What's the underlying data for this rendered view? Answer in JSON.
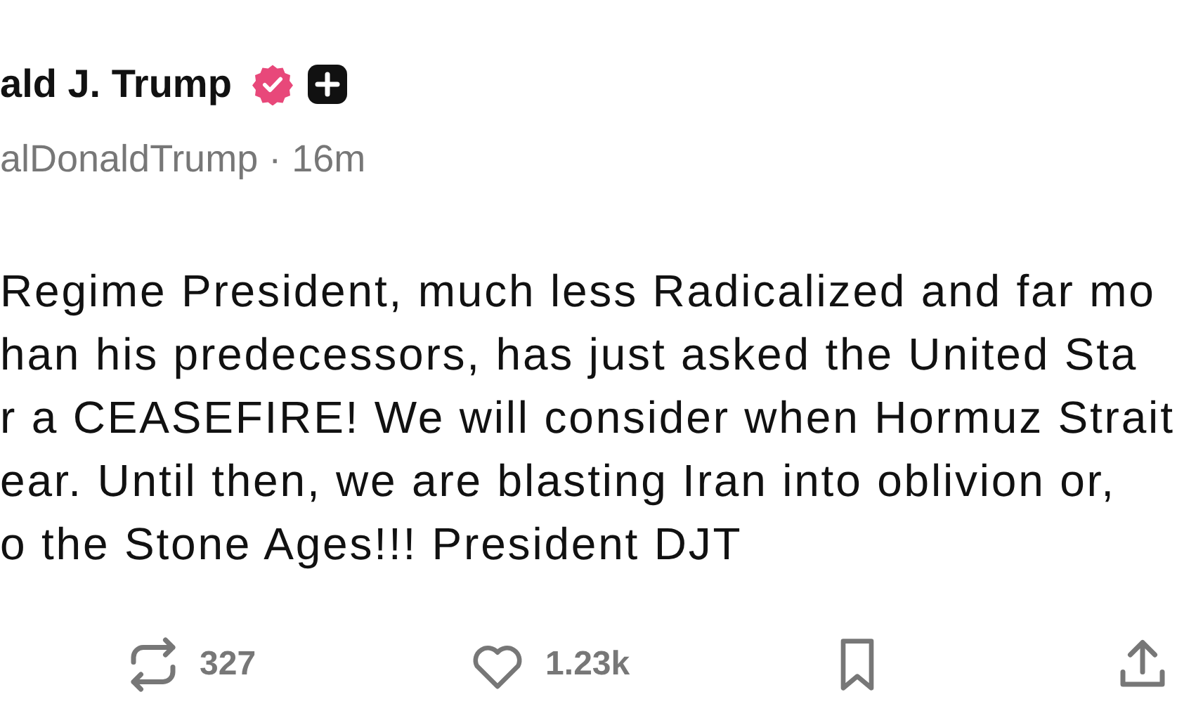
{
  "author": {
    "name": "ald J. Trump",
    "verified": true,
    "handle": "alDonaldTrump",
    "separator": "·",
    "time": "16m"
  },
  "post_lines": [
    "Regime President, much less Radicalized and far mo",
    "han his predecessors, has just asked the United Sta",
    "r a CEASEFIRE! We will consider when Hormuz Strait",
    "ear. Until then, we are blasting Iran into oblivion or,",
    "o the Stone Ages!!! President DJT"
  ],
  "actions": [
    {
      "kind": "repost",
      "count": "327"
    },
    {
      "kind": "like",
      "count": "1.23k"
    },
    {
      "kind": "bookmark"
    },
    {
      "kind": "share"
    }
  ]
}
